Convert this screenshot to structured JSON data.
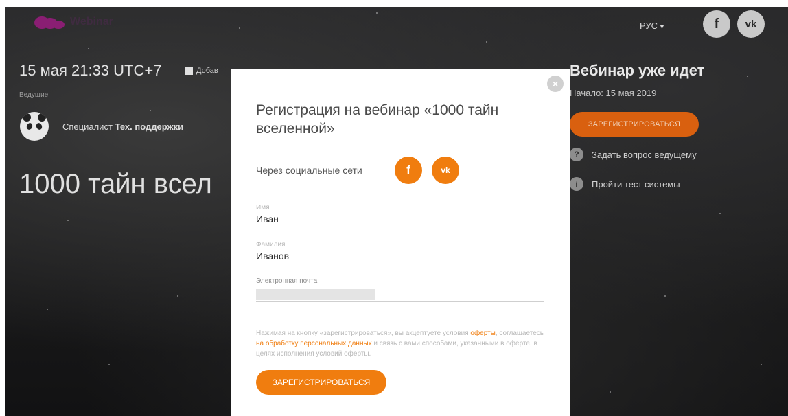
{
  "header": {
    "logo_text": "Webinar",
    "language": "РУС",
    "social_fb": "f",
    "social_vk": "vk"
  },
  "event": {
    "datetime": "15 мая 21:33 UTC+7",
    "add_to_calendar": "Добав",
    "hosts_label": "Ведущие",
    "host_role": "Специалист",
    "host_name": "Тех. поддержки",
    "title_partial": "1000 тайн всел"
  },
  "sidebar": {
    "status": "Вебинар уже идет",
    "start": "Начало: 15 мая 2019",
    "register_button": "ЗАРЕГИСТРИРОВАТЬСЯ",
    "ask_icon": "?",
    "ask_question": "Задать вопрос ведущему",
    "test_icon": "i",
    "system_test": "Пройти тест системы"
  },
  "modal": {
    "close": "×",
    "title": "Регистрация на вебинар «1000 тайн вселенной»",
    "social_label": "Через социальные сети",
    "social_fb": "f",
    "social_vk": "vk",
    "fields": {
      "first_name_label": "Имя",
      "first_name_value": "Иван",
      "last_name_label": "Фамилия",
      "last_name_value": "Иванов",
      "email_label": "Электронная почта"
    },
    "terms": {
      "part1": "Нажимая на кнопку «зарегистрироваться», вы акцептуете условия ",
      "link1": "оферты",
      "part2": ", соглашаетесь ",
      "link2": "на обработку персональных данных",
      "part3": " и связь с вами способами, указанными в оферте, в целях исполнения условий оферты."
    },
    "submit_button": "ЗАРЕГИСТРИРОВАТЬСЯ"
  },
  "colors": {
    "accent": "#f07d0f",
    "accent_dim": "#d9600f",
    "logo": "#8a1e73"
  }
}
